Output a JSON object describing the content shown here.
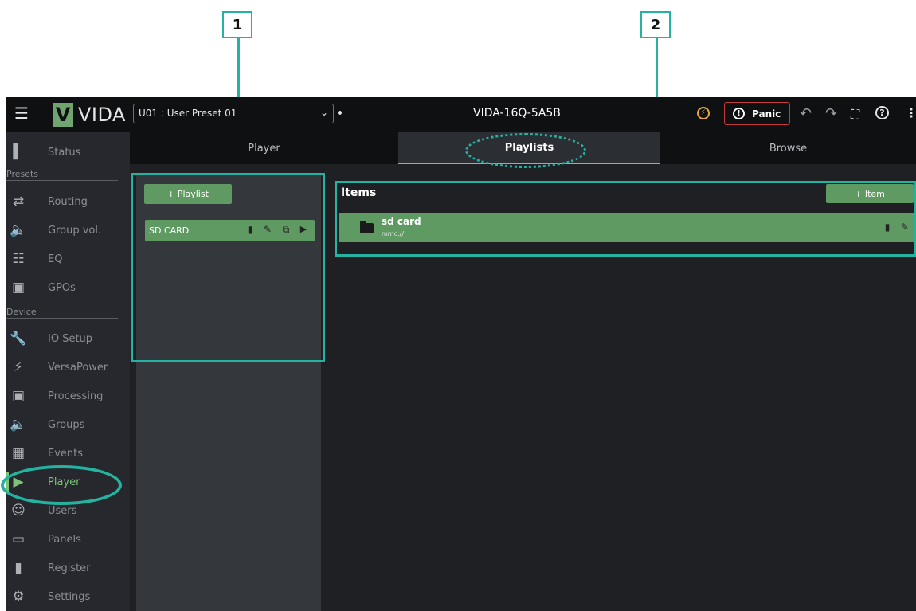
{
  "callouts": [
    "1",
    "2"
  ],
  "app": {
    "logo_mark": "V",
    "logo_text": "VIDA",
    "preset_value": "U01 : User Preset 01",
    "device_name": "VIDA-16Q-5A5B",
    "panic_label": "Panic"
  },
  "sidebar": {
    "sections": {
      "presets": "Presets",
      "device": "Device"
    },
    "items": [
      {
        "label": "Status",
        "icon": "bar-chart-icon"
      },
      {
        "label": "Routing",
        "icon": "routing-icon"
      },
      {
        "label": "Group vol.",
        "icon": "speaker-icon"
      },
      {
        "label": "EQ",
        "icon": "eq-sliders-icon"
      },
      {
        "label": "GPOs",
        "icon": "gpo-icon"
      },
      {
        "label": "IO Setup",
        "icon": "wrench-icon"
      },
      {
        "label": "VersaPower",
        "icon": "bolt-icon"
      },
      {
        "label": "Processing",
        "icon": "chip-icon"
      },
      {
        "label": "Groups",
        "icon": "speaker-icon"
      },
      {
        "label": "Events",
        "icon": "calendar-icon"
      },
      {
        "label": "Player",
        "icon": "play-circle-icon"
      },
      {
        "label": "Users",
        "icon": "users-icon"
      },
      {
        "label": "Panels",
        "icon": "panels-icon"
      },
      {
        "label": "Register",
        "icon": "file-icon"
      },
      {
        "label": "Settings",
        "icon": "gear-icon"
      }
    ],
    "active": "Player"
  },
  "tabs": [
    {
      "label": "Player"
    },
    {
      "label": "Playlists"
    },
    {
      "label": "Browse"
    }
  ],
  "active_tab": "Playlists",
  "playlists": {
    "add_label": "+ Playlist",
    "items": [
      {
        "label": "SD CARD"
      }
    ]
  },
  "items_panel": {
    "title": "Items",
    "add_label": "+ Item",
    "rows": [
      {
        "name": "sd card",
        "path": "mmc://"
      }
    ]
  },
  "colors": {
    "accent": "#5f9a63",
    "callout": "#23b3a0",
    "topbar": "#0f1012",
    "background": "#1e2024"
  }
}
